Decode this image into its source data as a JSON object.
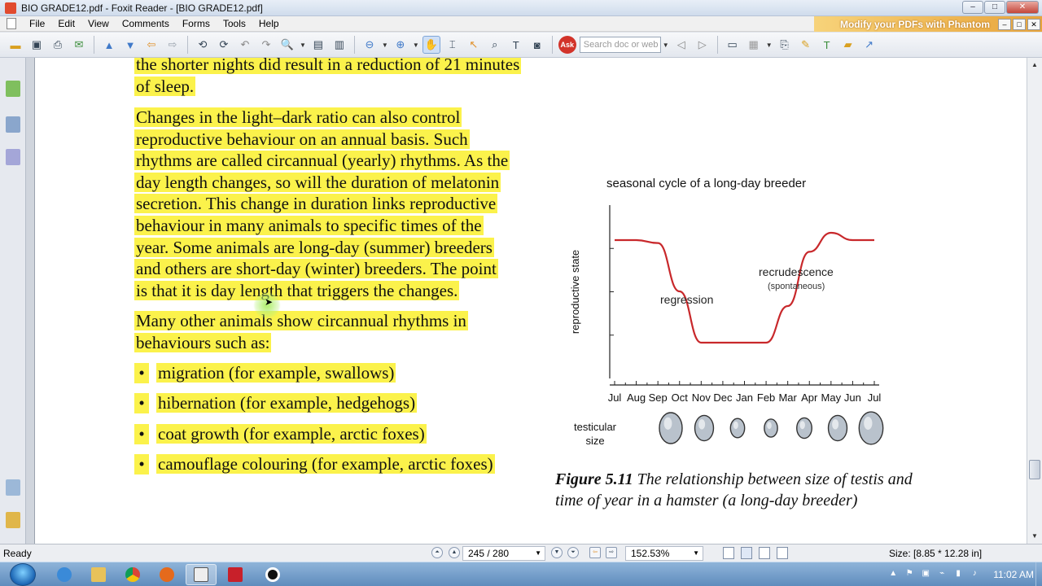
{
  "window": {
    "title": "BIO GRADE12.pdf - Foxit Reader - [BIO GRADE12.pdf]",
    "controls": {
      "minimize": "–",
      "maximize": "□",
      "close": "✕"
    }
  },
  "menu": {
    "items": [
      "File",
      "Edit",
      "View",
      "Comments",
      "Forms",
      "Tools",
      "Help"
    ],
    "banner": "Modify your PDFs with Phantom"
  },
  "toolbar": {
    "search_placeholder": "Search doc or web",
    "ask_label": "Ask"
  },
  "document": {
    "para1_lines": [
      "the shorter nights did result in a reduction of 21 minutes",
      "of sleep."
    ],
    "para2_lines": [
      "Changes in the light–dark ratio can also control",
      "reproductive behaviour on an annual basis. Such",
      "rhythms are called circannual (yearly) rhythms. As the",
      "day length changes, so will the duration of melatonin",
      "secretion. This change in duration links reproductive",
      "behaviour in many animals to specific times of the",
      "year. Some animals are long-day (summer) breeders",
      "and others are short-day (winter) breeders. The point",
      "is that it is day length that triggers the changes."
    ],
    "para3_lines": [
      "Many other animals show circannual rhythms in",
      "behaviours such as:"
    ],
    "bullet_symbol": "•",
    "bullets": [
      "migration (for example, swallows)",
      "hibernation (for example, hedgehogs)",
      "coat growth (for example, arctic foxes)",
      "camouflage colouring (for example, arctic foxes)"
    ],
    "highlight_color": "#fbf24b"
  },
  "figure": {
    "caption_label": "Figure 5.11",
    "caption_text": " The relationship between size of testis and time of year in a hamster (a long-day breeder)"
  },
  "chart_data": {
    "type": "line",
    "title": "seasonal cycle of a long-day breeder",
    "xlabel": "",
    "ylabel": "reproductive state",
    "x": [
      "Jul",
      "Aug",
      "Sep",
      "Oct",
      "Nov",
      "Dec",
      "Jan",
      "Feb",
      "Mar",
      "Apr",
      "May",
      "Jun",
      "Jul"
    ],
    "series": [
      {
        "values": [
          0.8,
          0.8,
          0.78,
          0.45,
          0.1,
          0.1,
          0.1,
          0.1,
          0.35,
          0.72,
          0.85,
          0.8,
          0.8
        ],
        "color": "#c8282b"
      }
    ],
    "ylim": [
      0,
      1
    ],
    "annotations": [
      {
        "text": "regression"
      },
      {
        "text": "recrudescence"
      },
      {
        "text": "(spontaneous)"
      }
    ],
    "testicular_size_label": [
      "testicular",
      "size"
    ],
    "testes_relative_sizes": [
      1.0,
      0.82,
      0.62,
      0.58,
      0.66,
      0.82,
      1.05
    ],
    "axis_color": "#222222"
  },
  "status": {
    "ready": "Ready",
    "page": "245 / 280",
    "zoom": "152.53%",
    "size": "Size: [8.85 * 12.28 in]"
  },
  "taskbar": {
    "clock": "11:02 AM"
  }
}
